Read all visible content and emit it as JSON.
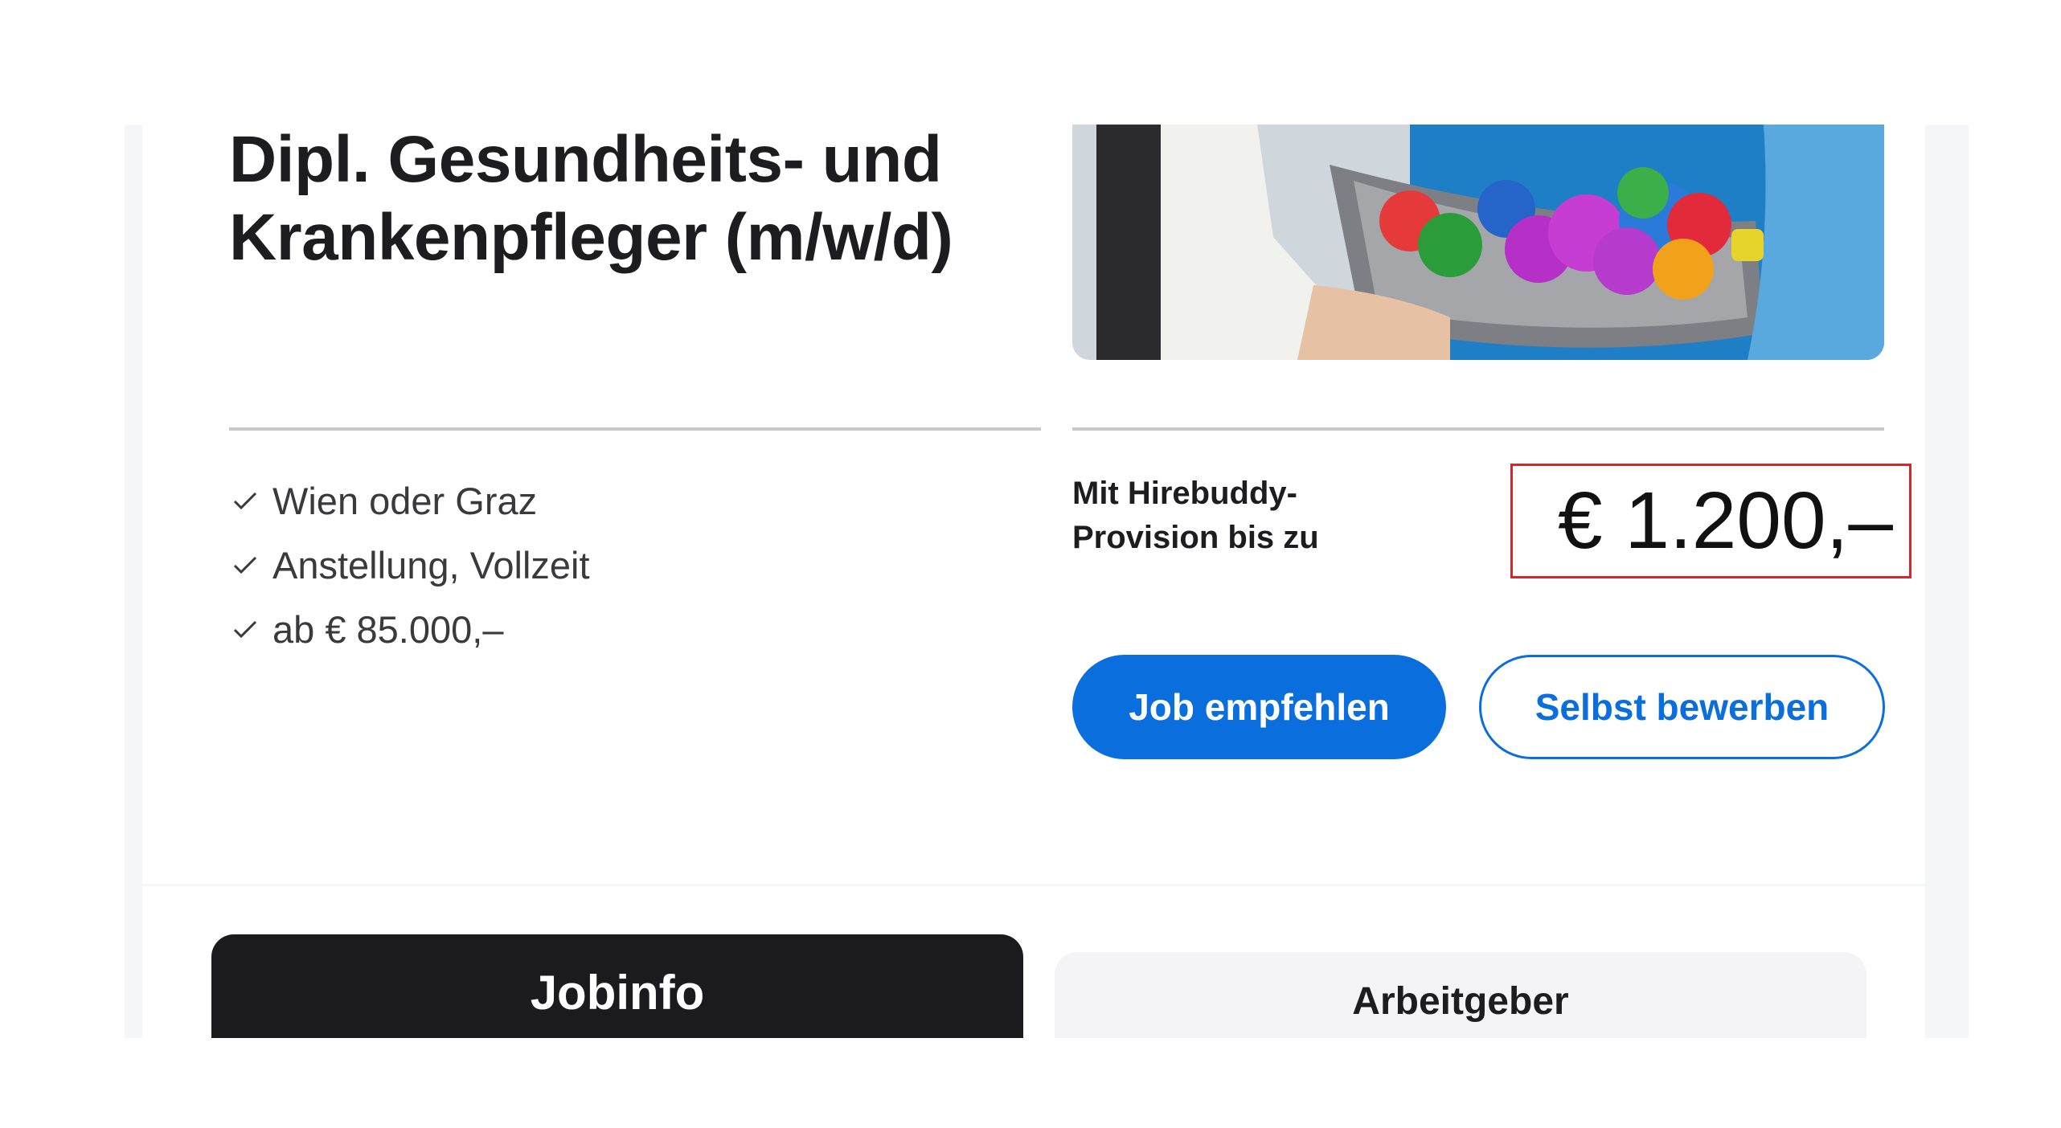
{
  "job": {
    "title": "Dipl. Gesundheits- und Krankenpfleger (m/w/d)",
    "image_alt": "Pflegekraft mit Kind und bunten Bällen"
  },
  "facts": [
    {
      "icon": "check-icon",
      "text": "Wien oder Graz"
    },
    {
      "icon": "check-icon",
      "text": "Anstellung, Vollzeit"
    },
    {
      "icon": "check-icon",
      "text": "ab € 85.000,–"
    }
  ],
  "provision": {
    "label": "Mit Hirebuddy-Provision bis zu",
    "amount": "€ 1.200,–",
    "highlight_color": "#d8252a"
  },
  "actions": {
    "recommend_label": "Job empfehlen",
    "apply_label": "Selbst bewerben",
    "accent_color": "#0a6fdc"
  },
  "tabs": [
    {
      "label": "Jobinfo",
      "active": true
    },
    {
      "label": "Arbeitgeber",
      "active": false
    }
  ]
}
